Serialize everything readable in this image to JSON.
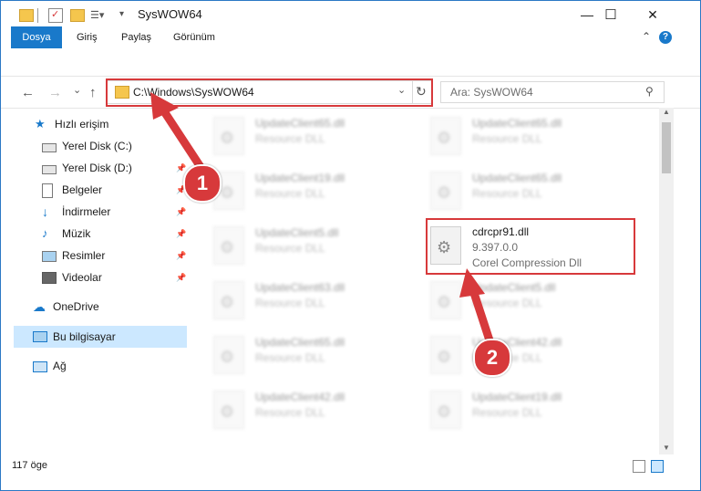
{
  "window": {
    "title": "SysWOW64",
    "minimize_glyph": "—",
    "maximize_glyph": "☐",
    "close_glyph": "✕",
    "help_glyph": "?",
    "collapse_glyph": "⌃"
  },
  "ribbon": {
    "tabs": [
      "Dosya",
      "Giriş",
      "Paylaş",
      "Görünüm"
    ]
  },
  "address": {
    "path": "C:\\Windows\\SysWOW64",
    "back_glyph": "←",
    "forward_glyph": "→",
    "recent_glyph": "⌄",
    "up_glyph": "↑",
    "dropdown_glyph": "⌄",
    "refresh_glyph": "↻"
  },
  "search": {
    "placeholder": "Ara: SysWOW64",
    "icon_glyph": "⚲"
  },
  "nav": {
    "quick_access": "Hızlı erişim",
    "items": [
      "Yerel Disk (C:)",
      "Yerel Disk (D:)",
      "Belgeler",
      "İndirmeler",
      "Müzik",
      "Resimler",
      "Videolar"
    ],
    "onedrive": "OneDrive",
    "this_pc": "Bu bilgisayar",
    "network": "Ağ",
    "pin_glyph": "📌"
  },
  "files": {
    "left_col": [
      {
        "name": "UpdateClient65.dll",
        "sub": "Resource DLL"
      },
      {
        "name": "UpdateClient19.dll",
        "sub": "Resource DLL"
      },
      {
        "name": "UpdateClient5.dll",
        "sub": "Resource DLL"
      },
      {
        "name": "UpdateClient63.dll",
        "sub": "Resource DLL"
      },
      {
        "name": "UpdateClient65.dll",
        "sub": "Resource DLL"
      },
      {
        "name": "UpdateClient42.dll",
        "sub": "Resource DLL"
      }
    ],
    "right_col": [
      {
        "name": "UpdateClient65.dll",
        "sub": "Resource DLL"
      },
      {
        "name": "UpdateClient65.dll",
        "sub": "Resource DLL"
      },
      {
        "name": "UpdateClient5.dll",
        "sub": "Resource DLL"
      },
      {
        "name": "UpdateClient42.dll",
        "sub": "Resource DLL"
      },
      {
        "name": "UpdateClient19.dll",
        "sub": "Resource DLL"
      }
    ],
    "highlight": {
      "name": "cdrcpr91.dll",
      "version": "9.397.0.0",
      "desc": "Corel Compression Dll"
    }
  },
  "status": {
    "count": "117 öge"
  },
  "markers": [
    "1",
    "2"
  ],
  "colors": {
    "accent": "#1979ca",
    "highlight": "#d7393b",
    "selected": "#cce8ff"
  }
}
